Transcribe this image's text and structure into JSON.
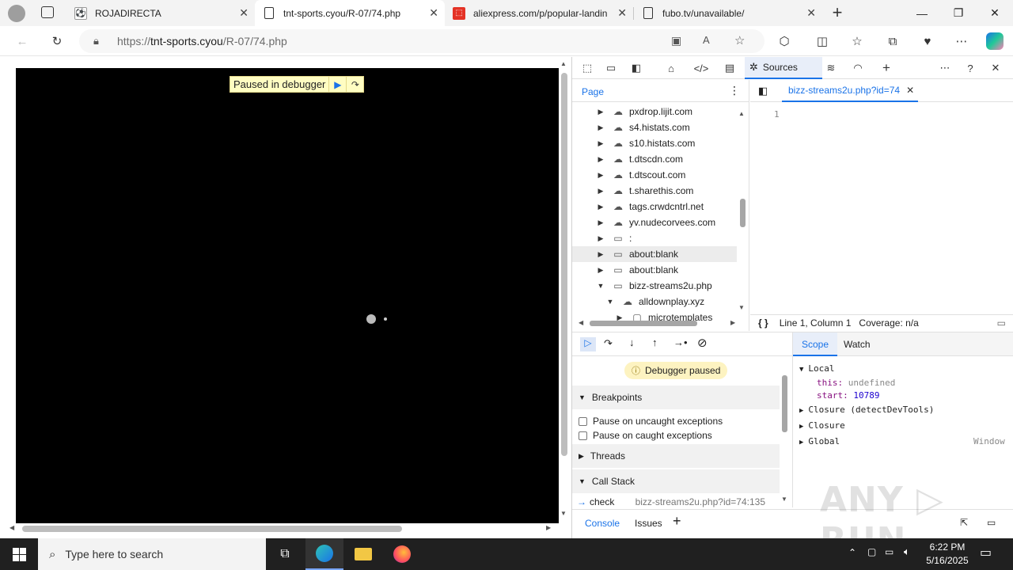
{
  "browser": {
    "tabs": [
      {
        "title": "ROJADIRECTA",
        "active": false
      },
      {
        "title": "tnt-sports.cyou/R-07/74.php",
        "active": true
      },
      {
        "title": "aliexpress.com/p/popular-landin",
        "active": false
      },
      {
        "title": "fubo.tv/unavailable/",
        "active": false
      }
    ],
    "new_tab_icon": "plus-icon",
    "url_scheme": "https://",
    "url_host": "tnt-sports.cyou",
    "url_path": "/R-07/74.php"
  },
  "page": {
    "paused_label": "Paused in debugger"
  },
  "devtools": {
    "active_panel": "Sources",
    "nav_tab": "Page",
    "tree": [
      {
        "label": "pxdrop.lijit.com",
        "icon": "cloud-icon",
        "depth": 0,
        "open": false
      },
      {
        "label": "s4.histats.com",
        "icon": "cloud-icon",
        "depth": 0,
        "open": false
      },
      {
        "label": "s10.histats.com",
        "icon": "cloud-icon",
        "depth": 0,
        "open": false
      },
      {
        "label": "t.dtscdn.com",
        "icon": "cloud-icon",
        "depth": 0,
        "open": false
      },
      {
        "label": "t.dtscout.com",
        "icon": "cloud-icon",
        "depth": 0,
        "open": false
      },
      {
        "label": "t.sharethis.com",
        "icon": "cloud-icon",
        "depth": 0,
        "open": false
      },
      {
        "label": "tags.crwdcntrl.net",
        "icon": "cloud-icon",
        "depth": 0,
        "open": false
      },
      {
        "label": "yv.nudecorvees.com",
        "icon": "cloud-icon",
        "depth": 0,
        "open": false
      },
      {
        "label": ":",
        "icon": "frame-icon",
        "depth": 0,
        "open": false
      },
      {
        "label": "about:blank",
        "icon": "frame-icon",
        "depth": 0,
        "open": false,
        "selected": true
      },
      {
        "label": "about:blank",
        "icon": "frame-icon",
        "depth": 0,
        "open": false
      },
      {
        "label": "bizz-streams2u.php",
        "icon": "frame-icon",
        "depth": 0,
        "open": true
      },
      {
        "label": "alldownplay.xyz",
        "icon": "cloud-icon",
        "depth": 1,
        "open": true
      },
      {
        "label": "microtemplates",
        "icon": "folder-icon",
        "depth": 2,
        "open": false
      }
    ],
    "editor_tab": "bizz-streams2u.php?id=74",
    "line_number": "1",
    "status_position": "Line 1, Column 1",
    "status_coverage": "Coverage: n/a",
    "paused_badge": "Debugger paused",
    "sections": {
      "breakpoints": "Breakpoints",
      "pause_uncaught": "Pause on uncaught exceptions",
      "pause_caught": "Pause on caught exceptions",
      "threads": "Threads",
      "call_stack": "Call Stack"
    },
    "call_frame": {
      "name": "check",
      "location": "bizz-streams2u.php?id=74:135"
    },
    "scope_tabs": [
      "Scope",
      "Watch"
    ],
    "scope": {
      "local": "Local",
      "this_key": "this:",
      "this_val": "undefined",
      "start_key": "start:",
      "start_val": "10789",
      "closure1": "Closure (detectDevTools)",
      "closure2": "Closure",
      "global": "Global",
      "global_val": "Window"
    },
    "drawer_tabs": [
      "Console",
      "Issues"
    ]
  },
  "taskbar": {
    "search_placeholder": "Type here to search",
    "time": "6:22 PM",
    "date": "5/16/2025"
  },
  "watermark": "ANY RUN"
}
